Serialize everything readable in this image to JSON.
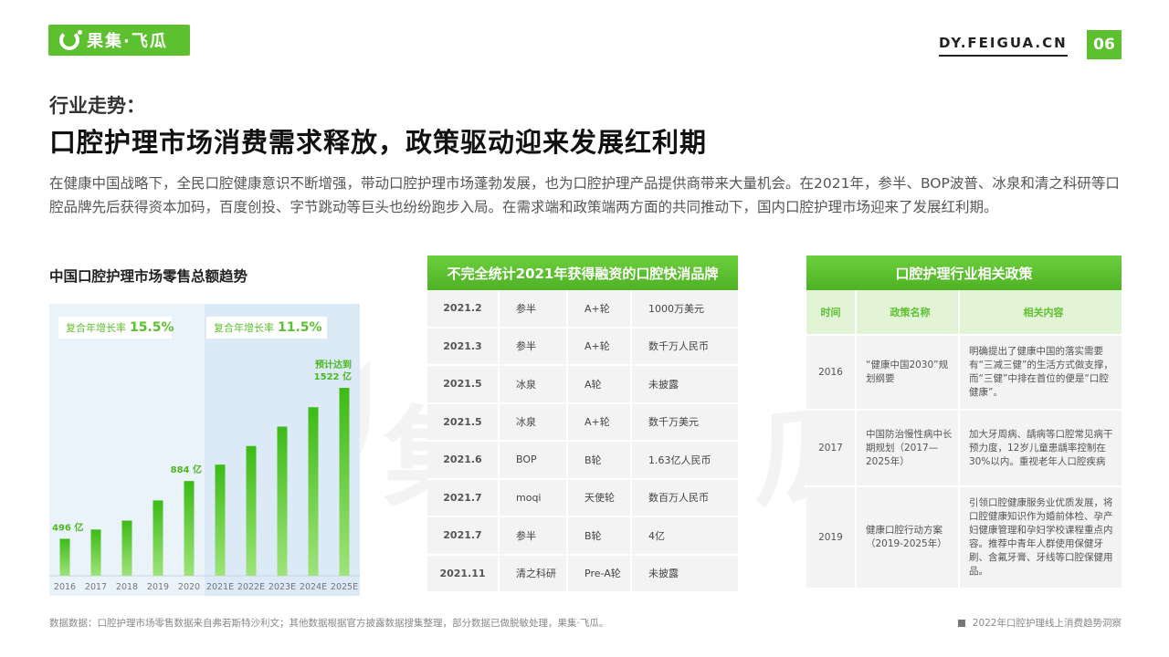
{
  "brand": {
    "logo_text": "果集·飞瓜",
    "site": "DY.FEIGUA.CN",
    "page_number": "06",
    "accent": "#5dc02f"
  },
  "header": {
    "kicker": "行业走势：",
    "headline": "口腔护理市场消费需求释放，政策驱动迎来发展红利期"
  },
  "intro": "在健康中国战略下，全民口腔健康意识不断增强，带动口腔护理市场蓬勃发展，也为口腔护理产品提供商带来大量机会。在2021年，参半、BOP波普、冰泉和清之科研等口腔品牌先后获得资本加码，百度创投、字节跳动等巨头也纷纷跑步入局。在需求端和政策端两方面的共同推动下，国内口腔护理市场迎来了发展红利期。",
  "chart_title": "中国口腔护理市场零售总额趋势",
  "cagr": [
    {
      "label": "复合年增长率",
      "value": "15.5%"
    },
    {
      "label": "复合年增长率",
      "value": "11.5%"
    }
  ],
  "chart_data": {
    "type": "bar",
    "categories": [
      "2016",
      "2017",
      "2018",
      "2019",
      "2020",
      "2021E",
      "2022E",
      "2023E",
      "2024E",
      "2025E"
    ],
    "values": [
      496,
      620,
      740,
      1010,
      1270,
      1490,
      1740,
      2000,
      2260,
      2520
    ],
    "forecast_start_index": 5,
    "labels": [
      {
        "index": 0,
        "text": "496 亿"
      },
      {
        "index": 4,
        "text": "884 亿"
      },
      {
        "index": 9,
        "text": "预计达到"
      },
      {
        "index": 9,
        "text": "1522 亿"
      }
    ]
  },
  "funding_table": {
    "title": "不完全统计2021年获得融资的口腔快消品牌",
    "rows": [
      [
        "2021.2",
        "参半",
        "A+轮",
        "1000万美元"
      ],
      [
        "2021.3",
        "参半",
        "A+轮",
        "数千万人民币"
      ],
      [
        "2021.5",
        "冰泉",
        "A轮",
        "未披露"
      ],
      [
        "2021.5",
        "冰泉",
        "A+轮",
        "数千万美元"
      ],
      [
        "2021.6",
        "BOP",
        "B轮",
        "1.63亿人民币"
      ],
      [
        "2021.7",
        "moqi",
        "天使轮",
        "数百万人民币"
      ],
      [
        "2021.7",
        "参半",
        "B轮",
        "4亿"
      ],
      [
        "2021.11",
        "清之科研",
        "Pre-A轮",
        "未披露"
      ]
    ]
  },
  "policy_table": {
    "title": "口腔护理行业相关政策",
    "headers": [
      "时间",
      "政策名称",
      "相关内容"
    ],
    "rows": [
      [
        "2016",
        "“健康中国2030”规划纲要",
        "明确提出了健康中国的落实需要有“三减三健”的生活方式做支撑，而“三健”中排在首位的便是“口腔健康”。"
      ],
      [
        "2017",
        "中国防治慢性病中长期规划（2017—2025年）",
        "加大牙周病、龋病等口腔常见病干预力度，12岁儿童患龋率控制在30%以内。重视老年人口腔疾病"
      ],
      [
        "2019",
        "健康口腔行动方案（2019-2025年）",
        "引领口腔健康服务业优质发展，将口腔健康知识作为婚前体检、孕产妇健康管理和孕妇学校课程重点内容。推荐中青年人群使用保健牙刷、含氟牙膏、牙线等口腔保健用品。"
      ]
    ]
  },
  "footer": {
    "source": "数据数据：口腔护理市场零售数据来自弗若斯特沙利文；其他数据根据官方披露数据搜集整理，部分数据已做脱敏处理，果集·飞瓜。",
    "report": "2022年口腔护理线上消费趋势洞察"
  }
}
